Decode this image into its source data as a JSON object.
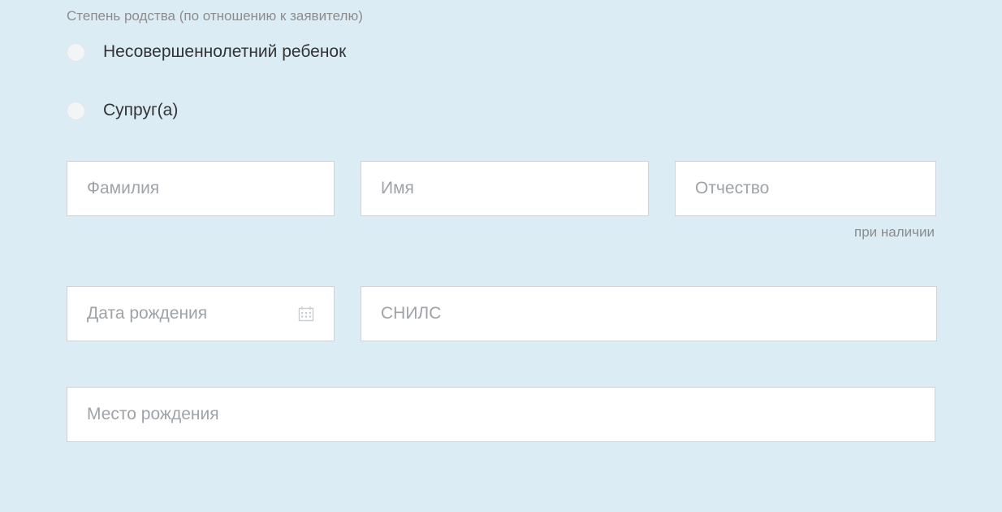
{
  "section": {
    "relationship_label": "Степень родства (по отношению к заявителю)",
    "options": {
      "child": "Несовершеннолетний ребенок",
      "spouse": "Супруг(а)"
    }
  },
  "fields": {
    "lastname": {
      "placeholder": "Фамилия"
    },
    "firstname": {
      "placeholder": "Имя"
    },
    "patronymic": {
      "placeholder": "Отчество",
      "helper": "при наличии"
    },
    "dob": {
      "placeholder": "Дата рождения"
    },
    "snils": {
      "placeholder": "СНИЛС"
    },
    "birthplace": {
      "placeholder": "Место рождения"
    }
  }
}
